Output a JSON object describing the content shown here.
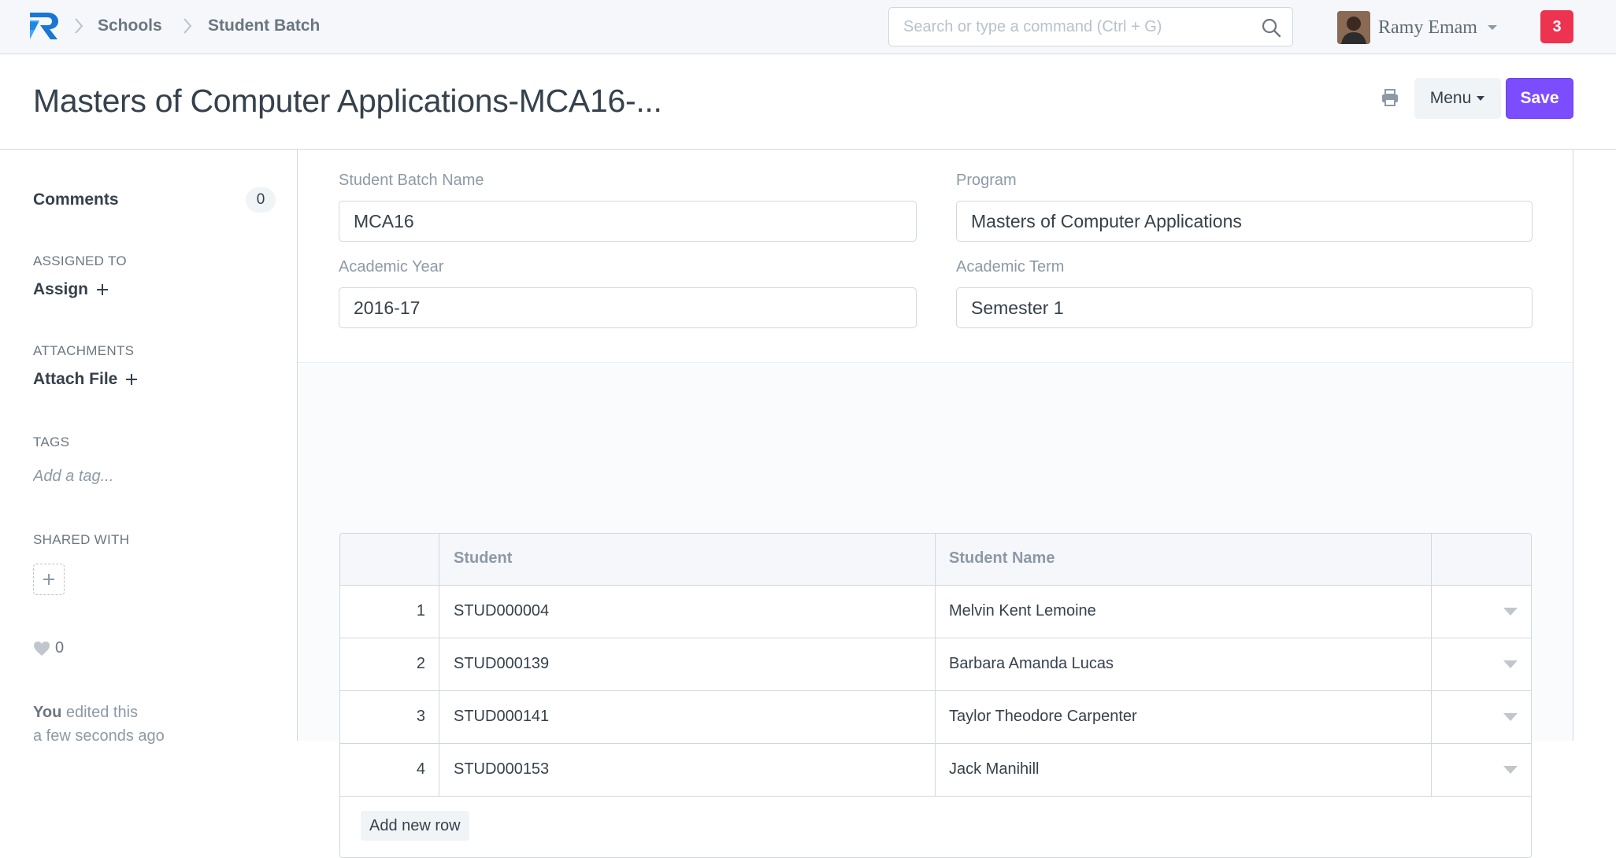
{
  "navbar": {
    "breadcrumbs": [
      "Schools",
      "Student Batch"
    ],
    "search_placeholder": "Search or type a command (Ctrl + G)",
    "user_name": "Ramy Emam",
    "notification_count": "3"
  },
  "page": {
    "title": "Masters of Computer Applications-MCA16-...",
    "menu_label": "Menu",
    "save_label": "Save"
  },
  "sidebar": {
    "comments_label": "Comments",
    "comments_count": "0",
    "assigned_to_label": "ASSIGNED TO",
    "assign_label": "Assign",
    "attachments_label": "ATTACHMENTS",
    "attach_label": "Attach File",
    "tags_label": "TAGS",
    "tag_placeholder": "Add a tag...",
    "shared_with_label": "SHARED WITH",
    "likes": "0",
    "edited_by": "You",
    "edited_text": "edited this",
    "edited_when": "a few seconds ago"
  },
  "form": {
    "fields": {
      "student_batch_name": {
        "label": "Student Batch Name",
        "value": "MCA16"
      },
      "program": {
        "label": "Program",
        "value": "Masters of Computer Applications"
      },
      "academic_year": {
        "label": "Academic Year",
        "value": "2016-17"
      },
      "academic_term": {
        "label": "Academic Term",
        "value": "Semester 1"
      }
    },
    "students_table": {
      "columns": [
        "Student",
        "Student Name"
      ],
      "rows": [
        {
          "idx": "1",
          "student": "STUD000004",
          "student_name": "Melvin Kent Lemoine"
        },
        {
          "idx": "2",
          "student": "STUD000139",
          "student_name": "Barbara Amanda Lucas"
        },
        {
          "idx": "3",
          "student": "STUD000141",
          "student_name": "Taylor Theodore Carpenter"
        },
        {
          "idx": "4",
          "student": "STUD000153",
          "student_name": "Jack Manihill"
        }
      ],
      "add_row_label": "Add new row"
    }
  },
  "colors": {
    "primary": "#7c4dff",
    "notification": "#ee3350",
    "logo_blue": "#1976d2",
    "logo_light": "#42a5f5"
  }
}
